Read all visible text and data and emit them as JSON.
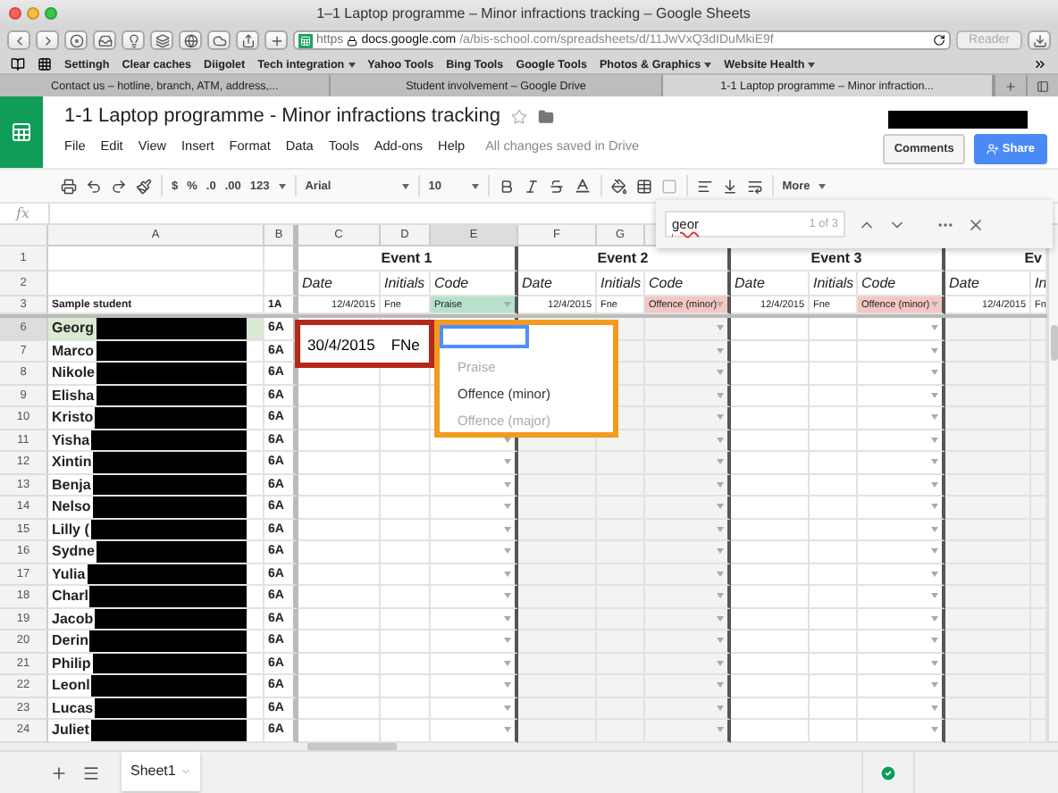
{
  "browser": {
    "title": "1–1 Laptop programme – Minor infractions tracking – Google Sheets",
    "address": {
      "scheme": "https",
      "host": "docs.google.com",
      "path": "/a/bis-school.com/spreadsheets/d/11JwVxQ3dIDuMkiE9f"
    },
    "reader": "Reader",
    "bookmarks": [
      {
        "label": "Settingh",
        "menu": false
      },
      {
        "label": "Clear caches",
        "menu": false
      },
      {
        "label": "Diigolet",
        "menu": false
      },
      {
        "label": "Tech integration",
        "menu": true
      },
      {
        "label": "Yahoo Tools",
        "menu": false
      },
      {
        "label": "Bing Tools",
        "menu": false
      },
      {
        "label": "Google Tools",
        "menu": false
      },
      {
        "label": "Photos & Graphics",
        "menu": true
      },
      {
        "label": "Website Health",
        "menu": true
      }
    ],
    "tabs": [
      {
        "label": "Contact us – hotline, branch, ATM, address,...",
        "selected": false
      },
      {
        "label": "Student involvement – Google Drive",
        "selected": false
      },
      {
        "label": "1-1 Laptop programme – Minor infraction...",
        "selected": true
      }
    ]
  },
  "app": {
    "title": "1-1 Laptop programme - Minor infractions tracking",
    "menu": [
      "File",
      "Edit",
      "View",
      "Insert",
      "Format",
      "Data",
      "Tools",
      "Add-ons",
      "Help"
    ],
    "save_status": "All changes saved in Drive",
    "comments": "Comments",
    "share": "Share"
  },
  "toolbar": {
    "number_formats": [
      "$",
      "%",
      ".0",
      ".00"
    ],
    "more_formats": "123",
    "font": "Arial",
    "size": "10",
    "more": "More"
  },
  "find": {
    "query": "geor",
    "count": "1 of 3"
  },
  "formula_label": "fx",
  "columns": [
    {
      "letter": "A",
      "selected": false
    },
    {
      "letter": "B",
      "selected": false
    },
    {
      "letter": "C",
      "selected": false
    },
    {
      "letter": "D",
      "selected": false
    },
    {
      "letter": "E",
      "selected": true
    },
    {
      "letter": "F",
      "selected": false
    },
    {
      "letter": "G",
      "selected": false
    }
  ],
  "header_rows": [
    "1",
    "2",
    "3"
  ],
  "events": [
    "Event 1",
    "Event 2",
    "Event 3",
    "Ev"
  ],
  "subheaders": [
    "Date",
    "Initials",
    "Code",
    "Date",
    "Initials",
    "Code",
    "Date",
    "Initials",
    "Code",
    "Date",
    "In"
  ],
  "sample": {
    "name": "Sample student",
    "class": "1A",
    "entries": [
      {
        "text": "12/4/2015"
      },
      {
        "text": "Fne"
      },
      {
        "text": "Praise",
        "color": "#b7e1cd"
      },
      {
        "text": "12/4/2015"
      },
      {
        "text": "Fne"
      },
      {
        "text": "Offence (minor)",
        "color": "#f4c7c3"
      },
      {
        "text": "12/4/2015"
      },
      {
        "text": "Fne"
      },
      {
        "text": "Offence (minor)",
        "color": "#f4c7c3"
      },
      {
        "text": "12/4/2015"
      },
      {
        "text": "Fn"
      }
    ]
  },
  "rows": [
    {
      "number": "6",
      "name": "Georg",
      "class": "6A",
      "selected": true
    },
    {
      "number": "7",
      "name": "Marco",
      "class": "6A",
      "selected": false
    },
    {
      "number": "8",
      "name": "Nikole",
      "class": "6A",
      "selected": false
    },
    {
      "number": "9",
      "name": "Elisha",
      "class": "6A",
      "selected": false
    },
    {
      "number": "10",
      "name": "Kristo",
      "class": "6A",
      "selected": false
    },
    {
      "number": "11",
      "name": "Yisha",
      "class": "6A",
      "selected": false
    },
    {
      "number": "12",
      "name": "Xintin",
      "class": "6A",
      "selected": false
    },
    {
      "number": "13",
      "name": "Benja",
      "class": "6A",
      "selected": false
    },
    {
      "number": "14",
      "name": "Nelso",
      "class": "6A",
      "selected": false
    },
    {
      "number": "15",
      "name": "Lilly (",
      "class": "6A",
      "selected": false
    },
    {
      "number": "16",
      "name": "Sydne",
      "class": "6A",
      "selected": false
    },
    {
      "number": "17",
      "name": "Yulia",
      "class": "6A",
      "selected": false
    },
    {
      "number": "18",
      "name": "Charl",
      "class": "6A",
      "selected": false
    },
    {
      "number": "19",
      "name": "Jacob",
      "class": "6A",
      "selected": false
    },
    {
      "number": "20",
      "name": "Derin",
      "class": "6A",
      "selected": false
    },
    {
      "number": "21",
      "name": "Philip",
      "class": "6A",
      "selected": false
    },
    {
      "number": "22",
      "name": "Leonl",
      "class": "6A",
      "selected": false
    },
    {
      "number": "23",
      "name": "Lucas",
      "class": "6A",
      "selected": false
    },
    {
      "number": "24",
      "name": "Juliet",
      "class": "6A",
      "selected": false
    }
  ],
  "callout": {
    "entries": [
      "30/4/2015",
      "FNe"
    ]
  },
  "dropdown": {
    "options": [
      {
        "label": "Praise",
        "selected": false
      },
      {
        "label": "Offence (minor)",
        "selected": true
      },
      {
        "label": "Offence (major)",
        "selected": false
      }
    ]
  },
  "sheet_tabs": [
    {
      "label": "Sheet1",
      "selected": true
    }
  ]
}
